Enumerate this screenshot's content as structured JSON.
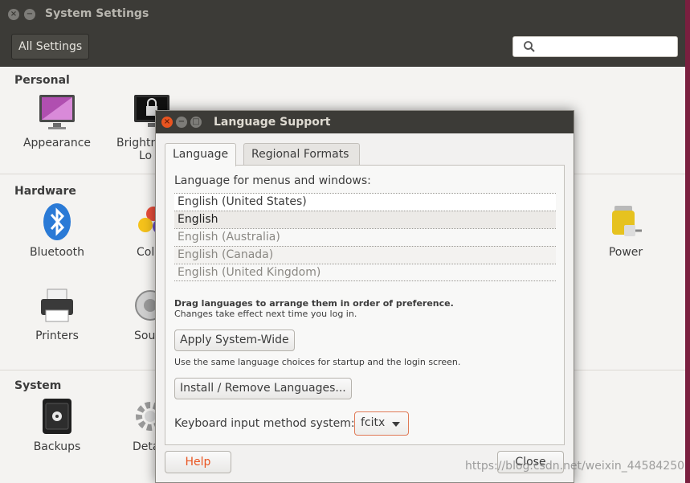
{
  "window": {
    "title": "System Settings",
    "all_settings_label": "All Settings",
    "search_placeholder": ""
  },
  "sections": {
    "personal": "Personal",
    "hardware": "Hardware",
    "system": "System"
  },
  "items": {
    "appearance": "Appearance",
    "brightness_line1": "Brightn",
    "brightness_line2": "Lo",
    "bluetooth": "Bluetooth",
    "color": "Col",
    "power": "Power",
    "printers": "Printers",
    "sound": "Sou",
    "backups": "Backups",
    "details": "Deta"
  },
  "dialog": {
    "title": "Language Support",
    "tabs": [
      "Language",
      "Regional Formats"
    ],
    "menus_label": "Language for menus and windows:",
    "languages": [
      "English (United States)",
      "English",
      "English (Australia)",
      "English (Canada)",
      "English (United Kingdom)"
    ],
    "drag_hint": "Drag languages to arrange them in order of preference.",
    "effect_note": "Changes take effect next time you log in.",
    "apply_button": "Apply System-Wide",
    "apply_note": "Use the same language choices for startup and the login screen.",
    "install_button": "Install / Remove Languages...",
    "keyboard_label": "Keyboard input method system:",
    "keyboard_value": "fcitx",
    "help_button": "Help",
    "close_button": "Close"
  },
  "watermark": {
    "prefix": "https://blog.csdn.net/weixin_",
    "suffix": "44584250"
  },
  "colors": {
    "accent": "#e95420",
    "titlebar": "#3c3b37",
    "background": "#f4f3f1"
  }
}
